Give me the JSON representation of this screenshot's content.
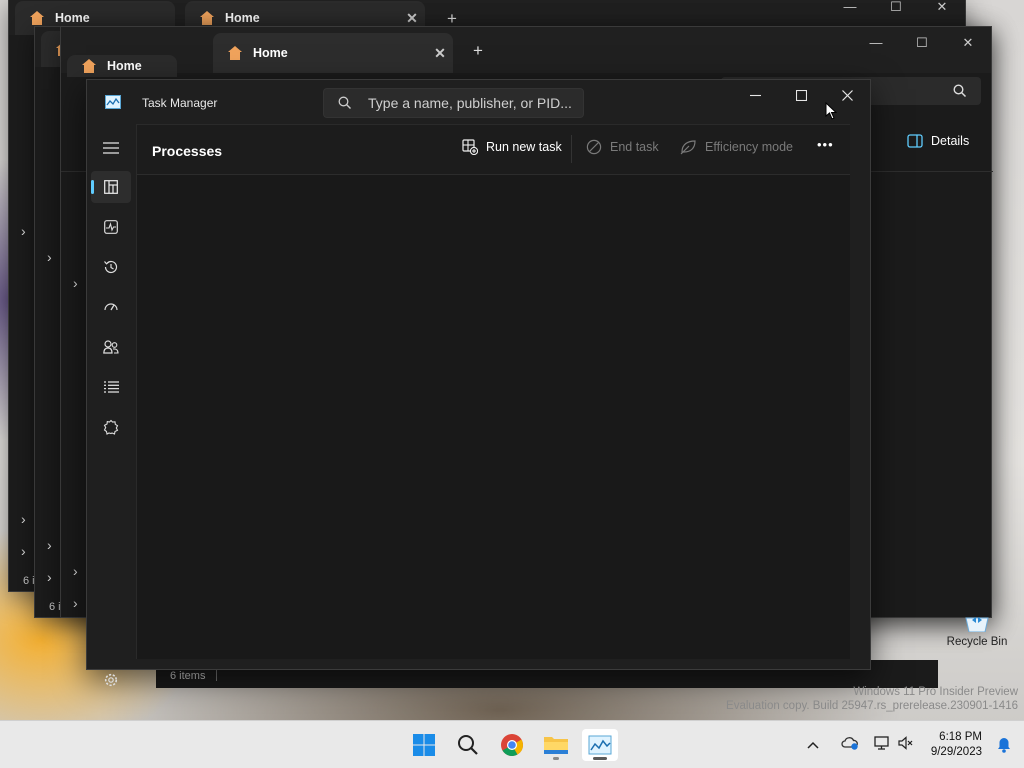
{
  "explorer": {
    "tab_label": "Home",
    "new_tab": "+",
    "close_glyph": "✕",
    "items_count": "6 items",
    "items_count_short": "6 i",
    "details_label": "Details"
  },
  "task_manager": {
    "title": "Task Manager",
    "search_placeholder": "Type a name, publisher, or PID...",
    "page_title": "Processes",
    "toolbar": {
      "run_new_task": "Run new task",
      "end_task": "End task",
      "efficiency_mode": "Efficiency mode",
      "more": "•••"
    },
    "nav": [
      {
        "name": "menu-icon"
      },
      {
        "name": "processes-icon"
      },
      {
        "name": "performance-icon"
      },
      {
        "name": "app-history-icon"
      },
      {
        "name": "startup-apps-icon"
      },
      {
        "name": "users-icon"
      },
      {
        "name": "details-icon"
      },
      {
        "name": "services-icon"
      },
      {
        "name": "settings-icon"
      }
    ],
    "accent": "#60cdff"
  },
  "desktop": {
    "recycle_bin": "Recycle Bin",
    "watermark_line1": "Windows 11 Pro Insider Preview",
    "watermark_line2": "Evaluation copy. Build 25947.rs_prerelease.230901-1416"
  },
  "taskbar": {
    "apps": [
      "start-icon",
      "search-icon",
      "chrome-icon",
      "file-explorer-icon",
      "task-manager-icon"
    ],
    "time": "6:18 PM",
    "date": "9/29/2023"
  }
}
